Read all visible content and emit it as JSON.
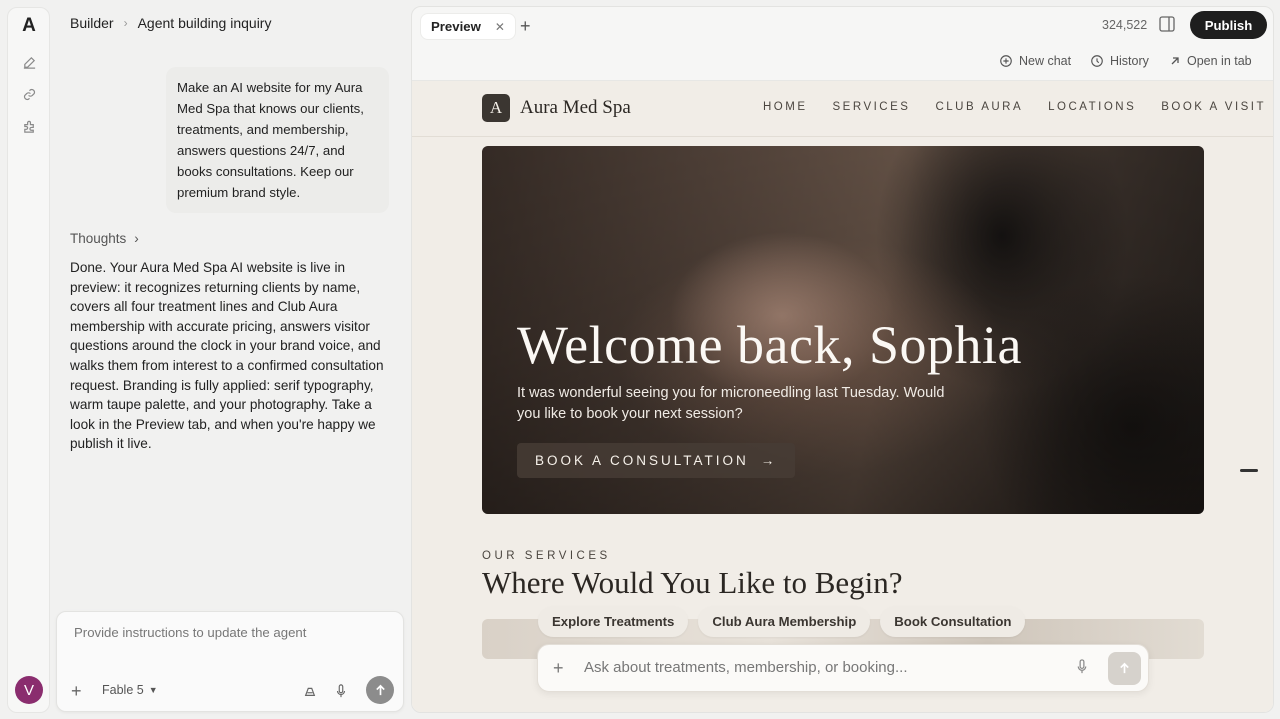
{
  "rail": {
    "logo": "A",
    "avatar_initial": "V"
  },
  "chat": {
    "breadcrumb": {
      "root": "Builder",
      "current": "Agent building inquiry"
    },
    "user_message": "Make an AI website for my Aura Med Spa that knows our clients, treatments, and membership, answers questions 24/7, and books consultations. Keep our premium brand style.",
    "thoughts_label": "Thoughts",
    "assistant_message": "Done. Your Aura Med Spa AI website is live in preview: it recognizes returning clients by name, covers all four treatment lines and Club Aura membership with accurate pricing, answers visitor questions around the clock in your brand voice, and walks them from interest to a confirmed consultation request. Branding is fully applied: serif typography, warm taupe palette, and your photography. Take a look in the Preview tab, and when you're happy we publish it live.",
    "composer": {
      "placeholder": "Provide instructions to update the agent",
      "model": "Fable 5"
    }
  },
  "preview": {
    "tab_label": "Preview",
    "counter": "324,522",
    "publish_label": "Publish",
    "actions": {
      "new_chat": "New chat",
      "history": "History",
      "open_in_tab": "Open in tab"
    }
  },
  "site": {
    "logo_letter": "A",
    "name": "Aura Med Spa",
    "nav": [
      "HOME",
      "SERVICES",
      "CLUB AURA",
      "LOCATIONS",
      "BOOK A VISIT"
    ],
    "hero": {
      "title": "Welcome back, Sophia",
      "subtitle": "It was wonderful seeing you for microneedling last Tuesday. Would you like to book your next session?",
      "cta": "BOOK A CONSULTATION"
    },
    "services": {
      "kicker": "OUR SERVICES",
      "title": "Where Would You Like to Begin?"
    },
    "chips": [
      "Explore Treatments",
      "Club Aura Membership",
      "Book Consultation"
    ],
    "ask_placeholder": "Ask about treatments, membership, or booking..."
  },
  "colors": {
    "publish": "#1e1e1e",
    "avatar": "#8a2d6e",
    "site_bg": "#f1ede7",
    "brand_dark": "#3b3631"
  }
}
